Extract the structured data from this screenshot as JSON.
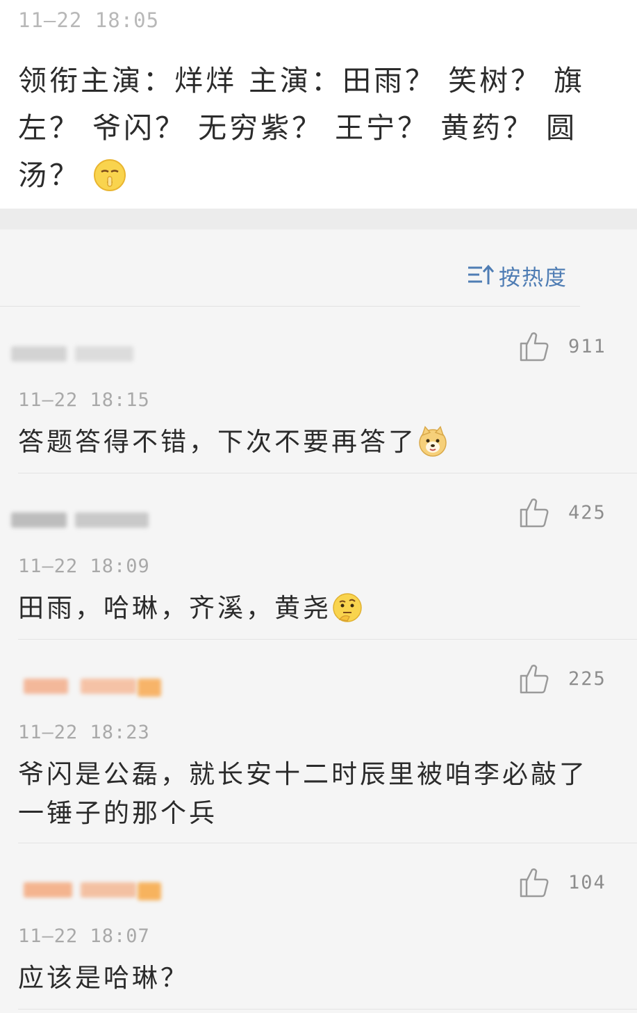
{
  "post": {
    "time": "11—22  18:05",
    "text": "领衔主演：烊烊  主演：田雨？ 笑树？ 旗左？ 爷闪？ 无穷紫？ 王宁？ 黄药？ 圆汤？",
    "emoji": "shush-face-emoji"
  },
  "sort": {
    "icon": "sort-icon",
    "label": "按热度"
  },
  "comments": [
    {
      "time": "11—22  18:15",
      "text": "答题答得不错，下次不要再答了",
      "emoji": "doge-emoji",
      "likes": "911",
      "name_colors": [
        "#cfcfcf",
        "#dcdcdc"
      ]
    },
    {
      "time": "11—22  18:09",
      "text": "田雨，哈琳，齐溪，黄尧",
      "emoji": "thinking-face-emoji",
      "likes": "425",
      "name_colors": [
        "#bdbdbd",
        "#cfcfcf"
      ]
    },
    {
      "time": "11—22  18:23",
      "text": "爷闪是公磊，就长安十二时辰里被咱李必敲了一锤子的那个兵",
      "emoji": "",
      "likes": "225",
      "name_colors": [
        "#f3b89a",
        "#f5c2a6",
        "#f7b469"
      ]
    },
    {
      "time": "11—22  18:07",
      "text": "应该是哈琳？",
      "emoji": "",
      "likes": "104",
      "name_colors": [
        "#f4b48f",
        "#f3c0a2",
        "#f7b35e"
      ]
    }
  ],
  "colors": {
    "accent": "#4f7db4",
    "background": "#f5f5f5",
    "text": "#2b2b2b",
    "meta": "#a9a9a9"
  }
}
